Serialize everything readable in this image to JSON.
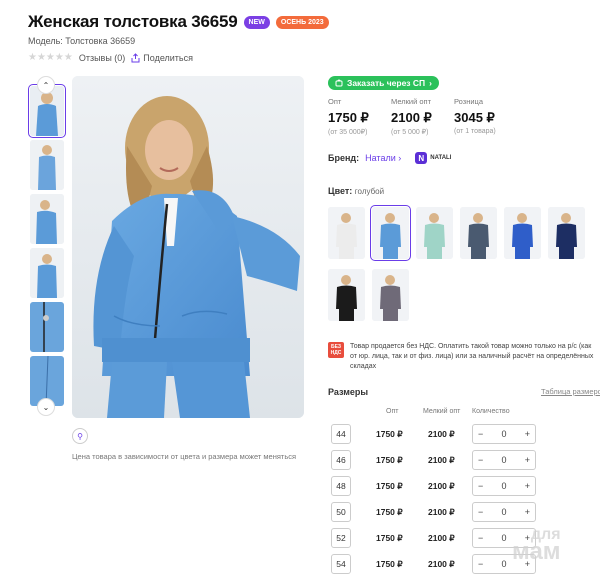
{
  "product": {
    "title": "Женская толстовка 36659",
    "badge_new": "NEW",
    "badge_season": "ОСЕНЬ 2023",
    "model": "Модель: Толстовка 36659",
    "stars": "★★★★★",
    "reviews": "Отзывы (0)",
    "share": "Поделиться"
  },
  "gallery": {
    "price_note": "Цена товара в зависимости от цвета и размера может меняться",
    "thumb_up": "⌃",
    "thumb_down": "⌄",
    "zoom_glyph": "⚲"
  },
  "joint_purchase": {
    "label": "Заказать через СП",
    "arrow": "›"
  },
  "prices": [
    {
      "label": "Опт",
      "value": "1750 ₽",
      "sub": "(от 35 000₽)"
    },
    {
      "label": "Мелкий опт",
      "value": "2100 ₽",
      "sub": "(от 5 000 ₽)"
    },
    {
      "label": "Розница",
      "value": "3045 ₽",
      "sub": "(от 1 товара)"
    }
  ],
  "brand": {
    "label": "Бренд:",
    "name": "Натали",
    "chevron": "›",
    "logo_letter": "N",
    "logo_text": "NATALI"
  },
  "color": {
    "label": "Цвет:",
    "value": "голубой"
  },
  "swatches": [
    {
      "name": "white",
      "coat": "#ececec"
    },
    {
      "name": "blue",
      "coat": "#5b9bd8"
    },
    {
      "name": "mint",
      "coat": "#9fd4c7"
    },
    {
      "name": "graphite",
      "coat": "#4a5a70"
    },
    {
      "name": "royal-blue",
      "coat": "#2f5ec9"
    },
    {
      "name": "navy",
      "coat": "#1d2e63"
    },
    {
      "name": "black",
      "coat": "#1b1b1b"
    },
    {
      "name": "grey",
      "coat": "#6f6a78"
    }
  ],
  "vat": {
    "icon_line1": "БЕЗ",
    "icon_line2": "НДС",
    "text": "Товар продается без НДС. Оплатить такой товар можно только на р/с (как от юр. лица, так и от физ. лица) или за наличный расчёт на определённых складах"
  },
  "sizes": {
    "title": "Размеры",
    "table_link": "Таблица размеров",
    "col_opt": "Опт",
    "col_small_opt": "Мелкий опт",
    "col_qty": "Количество",
    "minus": "−",
    "plus": "+",
    "rows": [
      {
        "size": "44",
        "opt": "1750 ₽",
        "small": "2100 ₽",
        "qty": "0"
      },
      {
        "size": "46",
        "opt": "1750 ₽",
        "small": "2100 ₽",
        "qty": "0"
      },
      {
        "size": "48",
        "opt": "1750 ₽",
        "small": "2100 ₽",
        "qty": "0"
      },
      {
        "size": "50",
        "opt": "1750 ₽",
        "small": "2100 ₽",
        "qty": "0"
      },
      {
        "size": "52",
        "opt": "1750 ₽",
        "small": "2100 ₽",
        "qty": "0"
      },
      {
        "size": "54",
        "opt": "1750 ₽",
        "small": "2100 ₽",
        "qty": "0"
      }
    ]
  },
  "watermark": {
    "line1": "для",
    "line2": "мам"
  },
  "colors": {
    "accent": "#6a3de8",
    "green": "#2bc15b",
    "badge_new": "#7b3fe4",
    "badge_season": "#f36b3b",
    "product_blue": "#5b9bd8"
  }
}
